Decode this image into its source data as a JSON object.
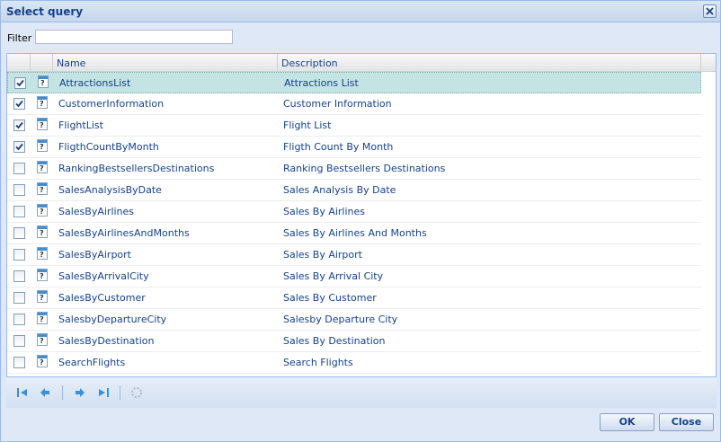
{
  "dialog": {
    "title": "Select query"
  },
  "filter": {
    "label": "Filter",
    "value": ""
  },
  "grid": {
    "columns": {
      "name": "Name",
      "description": "Description"
    },
    "rows": [
      {
        "name": "AttractionsList",
        "description": "Attractions List",
        "checked": true,
        "selected": true
      },
      {
        "name": "CustomerInformation",
        "description": "Customer Information",
        "checked": true
      },
      {
        "name": "FlightList",
        "description": "Flight List",
        "checked": true
      },
      {
        "name": "FligthCountByMonth",
        "description": "Fligth Count By Month",
        "checked": true
      },
      {
        "name": "RankingBestsellersDestinations",
        "description": "Ranking Bestsellers Destinations",
        "checked": false
      },
      {
        "name": "SalesAnalysisByDate",
        "description": "Sales Analysis By Date",
        "checked": false
      },
      {
        "name": "SalesByAirlines",
        "description": "Sales By Airlines",
        "checked": false
      },
      {
        "name": "SalesByAirlinesAndMonths",
        "description": "Sales By Airlines And Months",
        "checked": false
      },
      {
        "name": "SalesByAirport",
        "description": "Sales By Airport",
        "checked": false
      },
      {
        "name": "SalesByArrivalCity",
        "description": "Sales By Arrival City",
        "checked": false
      },
      {
        "name": "SalesByCustomer",
        "description": "Sales By Customer",
        "checked": false
      },
      {
        "name": "SalesbyDepartureCity",
        "description": "Salesby Departure City",
        "checked": false
      },
      {
        "name": "SalesByDestination",
        "description": "Sales By Destination",
        "checked": false
      },
      {
        "name": "SearchFlights",
        "description": "Search Flights",
        "checked": false
      }
    ]
  },
  "pager": {
    "icons": [
      "first-page-icon",
      "prev-page-icon",
      "next-page-icon",
      "last-page-icon",
      "refresh-icon"
    ]
  },
  "buttons": {
    "ok": "OK",
    "close": "Close"
  },
  "colors": {
    "accent": "#15428b",
    "header_bg": "#c6d6ec",
    "selected_row": "#c4e3e3",
    "icon_blue": "#3a8fd6"
  }
}
